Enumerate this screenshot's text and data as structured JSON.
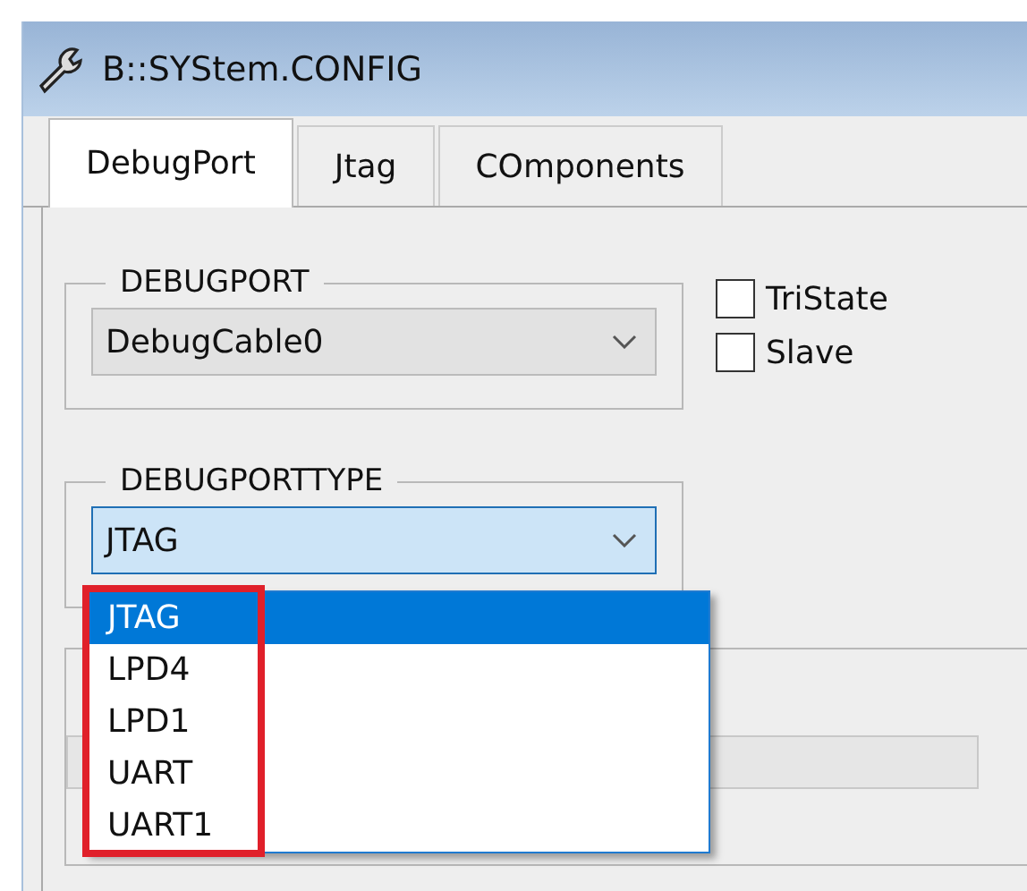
{
  "window": {
    "title": "B::SYStem.CONFIG"
  },
  "tabs": [
    {
      "label": "DebugPort",
      "selected": true
    },
    {
      "label": "Jtag",
      "selected": false
    },
    {
      "label": "COmponents",
      "selected": false
    }
  ],
  "debugport": {
    "label": "DEBUGPORT",
    "value": "DebugCable0",
    "disabled": true
  },
  "options": [
    {
      "label": "TriState",
      "checked": false
    },
    {
      "label": "Slave",
      "checked": false
    }
  ],
  "debugporttype": {
    "label": "DEBUGPORTTYPE",
    "value": "JTAG",
    "expanded": true,
    "items": [
      {
        "label": "JTAG",
        "selected": true
      },
      {
        "label": "LPD4",
        "selected": false
      },
      {
        "label": "LPD1",
        "selected": false
      },
      {
        "label": "UART",
        "selected": false
      },
      {
        "label": "UART1",
        "selected": false
      }
    ]
  }
}
